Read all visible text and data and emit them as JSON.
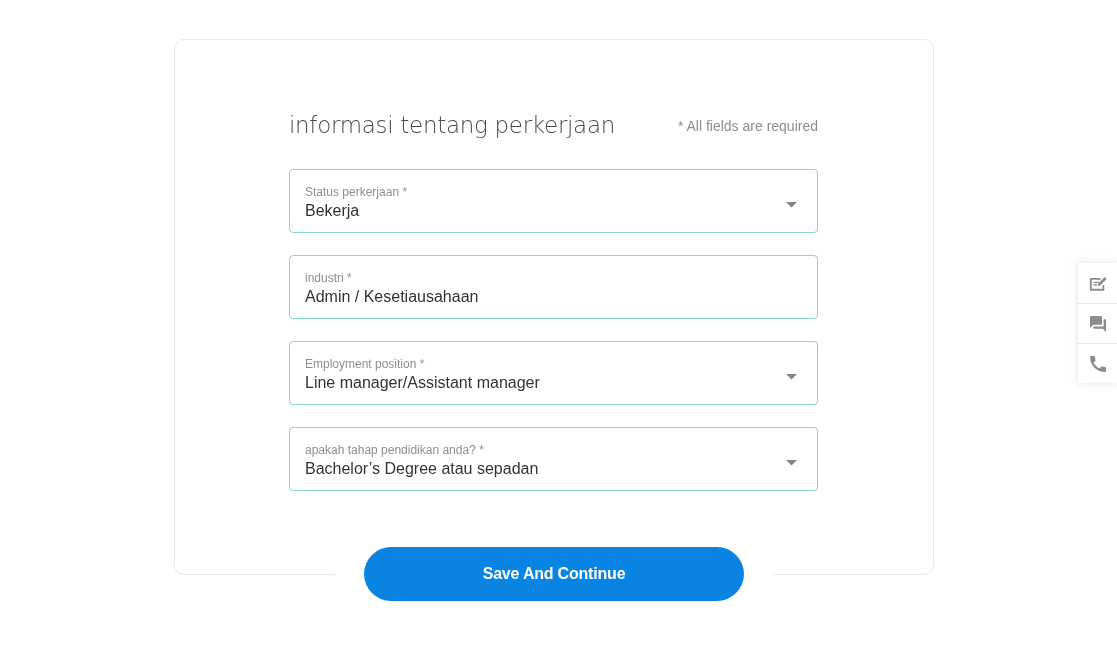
{
  "form": {
    "title": "informasi tentang perkerjaan",
    "required_note": "* All fields are required",
    "fields": [
      {
        "kind": "select",
        "label": "Status perkerjaan *",
        "value": "Bekerja"
      },
      {
        "kind": "text",
        "label": "industri *",
        "value": "Admin / Kesetiausahaan"
      },
      {
        "kind": "select",
        "label": "Employment position *",
        "value": "Line manager/Assistant manager"
      },
      {
        "kind": "select",
        "label": "apakah tahap pendidikan anda? *",
        "value": "Bachelor’s Degree atau sepadan"
      }
    ],
    "submit_button": "Save And Continue"
  }
}
